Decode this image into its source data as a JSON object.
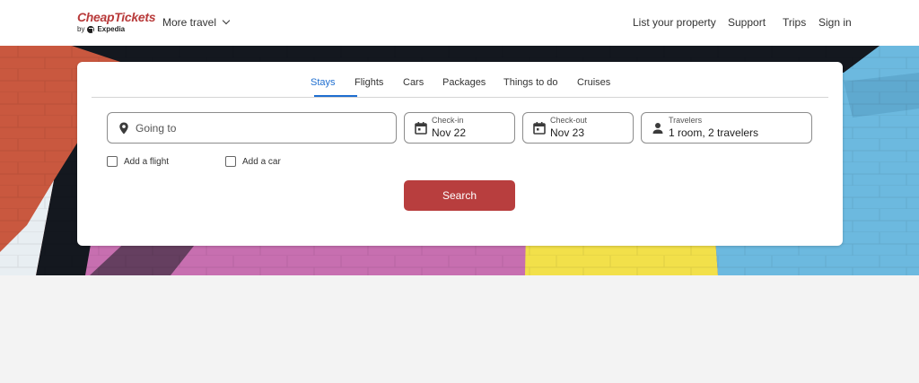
{
  "brand": {
    "name": "CheapTickets",
    "by": "by",
    "parent": "Expedia",
    "color": "#b83a3a"
  },
  "header": {
    "more_travel": "More travel",
    "list_property": "List your property",
    "support": "Support",
    "trips": "Trips",
    "sign_in": "Sign in"
  },
  "tabs": [
    {
      "label": "Stays",
      "active": true
    },
    {
      "label": "Flights",
      "active": false
    },
    {
      "label": "Cars",
      "active": false
    },
    {
      "label": "Packages",
      "active": false
    },
    {
      "label": "Things to do",
      "active": false
    },
    {
      "label": "Cruises",
      "active": false
    }
  ],
  "search": {
    "going_to_placeholder": "Going to",
    "checkin_label": "Check-in",
    "checkin_value": "Nov 22",
    "checkout_label": "Check-out",
    "checkout_value": "Nov 23",
    "travelers_label": "Travelers",
    "travelers_value": "1 room, 2 travelers",
    "add_flight": "Add a flight",
    "add_car": "Add a car",
    "button": "Search"
  },
  "colors": {
    "accent": "#1e6ed0",
    "button": "#b83e3e",
    "hero_orange": "#c9583f",
    "hero_pink": "#c76fb0",
    "hero_yellow": "#f2e04a",
    "hero_blue": "#6cb9df"
  },
  "icons": {
    "going_to": "map-pin-icon",
    "checkin": "calendar-icon",
    "checkout": "calendar-icon",
    "travelers": "person-icon",
    "more_travel": "chevron-down-icon"
  }
}
